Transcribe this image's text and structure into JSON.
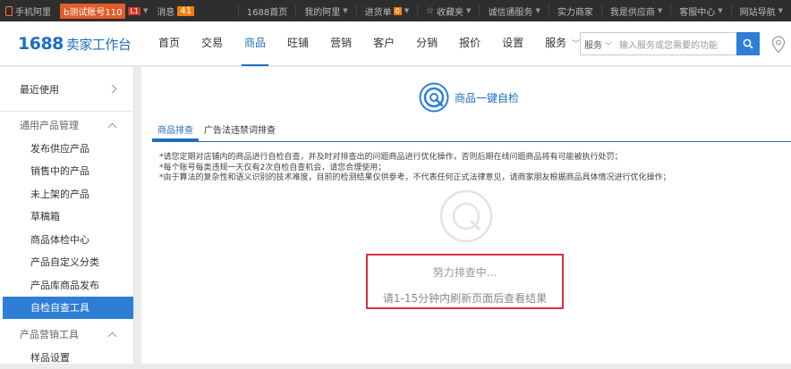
{
  "topbar": {
    "phone_label": "手机阿里",
    "account_label": "b测试账号110",
    "level_badge": "L1",
    "message_label": "消息",
    "message_count": "41",
    "links": [
      "1688首页",
      "我的阿里",
      "进货单",
      "收藏夹",
      "诚信通服务",
      "实力商家",
      "我是供应商",
      "客服中心",
      "网站导航"
    ],
    "cart_count": "0"
  },
  "header": {
    "logo": "1688",
    "logo_sub": "卖家工作台",
    "nav": [
      "首页",
      "交易",
      "商品",
      "旺铺",
      "营销",
      "客户",
      "分销",
      "报价",
      "设置",
      "服务"
    ],
    "active_nav_index": 2,
    "search_select": "服务",
    "search_placeholder": "输入服务或您需要的功能"
  },
  "sidebar": {
    "recent": "最近使用",
    "group1": "通用产品管理",
    "items": [
      "发布供应产品",
      "销售中的产品",
      "未上架的产品",
      "草稿箱",
      "商品体检中心",
      "产品自定义分类",
      "产品库商品发布",
      "自检自查工具"
    ],
    "active_item_index": 7,
    "group2": "产品营销工具",
    "group2_items": [
      "样品设置"
    ]
  },
  "main": {
    "title": "商品一键自检",
    "tabs": [
      "商品排查",
      "广告法违禁词排查"
    ],
    "active_tab_index": 0,
    "notes": [
      "*请您定期对店铺内的商品进行自检自查，并及时对排查出的问题商品进行优化操作，否则后期在线问题商品将有可能被执行处罚；",
      "*每个账号每类违规一天仅有2次自检自查机会，请您合理使用；",
      "*由于算法的复杂性和语义识别的技术难度，目前的检测结果仅供参考，不代表任何正式法律意见，请商家朋友根据商品具体情况进行优化操作；"
    ],
    "status_line1": "努力排查中...",
    "status_line2": "请1-15分钟内刷新页面后查看结果"
  },
  "colors": {
    "brand_blue": "#1d6fbf",
    "button_blue": "#2e7ed5",
    "highlight_red": "#d9323a",
    "topbar_bg": "#2e2e2e"
  }
}
